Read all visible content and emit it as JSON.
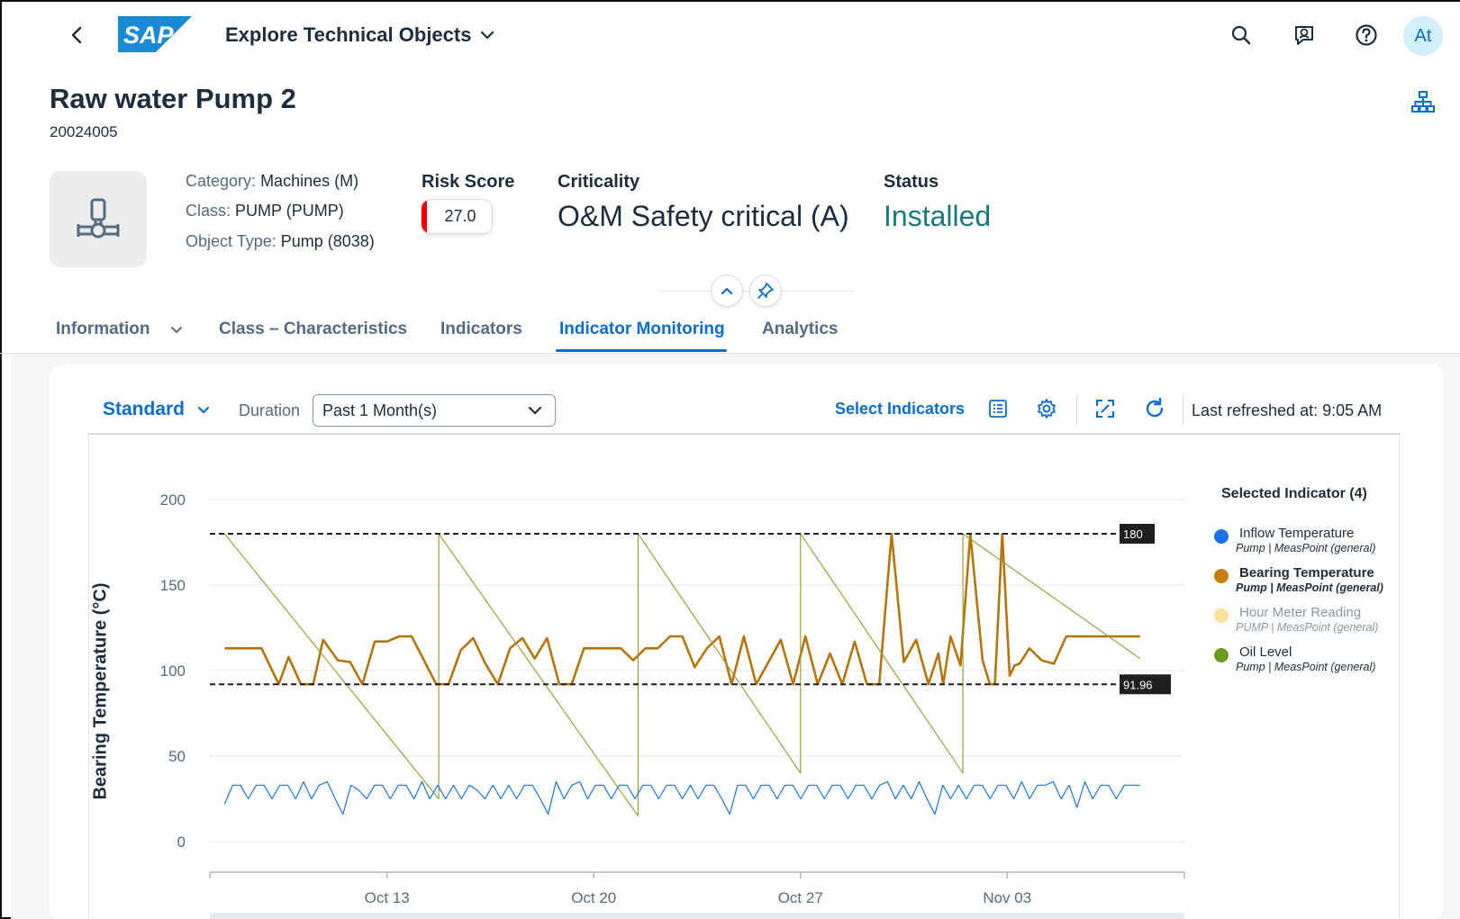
{
  "shell": {
    "logo_text": "SAP",
    "app_title": "Explore Technical Objects",
    "avatar_initials": "At",
    "icons": [
      "back-icon",
      "search-icon",
      "feedback-icon",
      "help-icon"
    ]
  },
  "object": {
    "title": "Raw water Pump 2",
    "id": "20024005",
    "attributes": [
      {
        "label": "Category:",
        "value": "Machines (M)"
      },
      {
        "label": "Class:",
        "value": "PUMP (PUMP)"
      },
      {
        "label": "Object Type:",
        "value": "Pump (8038)"
      }
    ],
    "risk_label": "Risk Score",
    "risk_value": "27.0",
    "criticality_label": "Criticality",
    "criticality_value": "O&M Safety critical (A)",
    "status_label": "Status",
    "status_value": "Installed",
    "status_color": "#1a7a7a"
  },
  "tabs": [
    {
      "label": "Information",
      "has_dropdown": true
    },
    {
      "label": "Class – Characteristics"
    },
    {
      "label": "Indicators"
    },
    {
      "label": "Indicator Monitoring",
      "active": true
    },
    {
      "label": "Analytics"
    }
  ],
  "toolbar": {
    "variant": "Standard",
    "duration_label": "Duration",
    "duration_value": "Past 1 Month(s)",
    "select_indicators": "Select Indicators",
    "last_refreshed_label": "Last refreshed at:",
    "last_refreshed_time": "9:05 AM",
    "icons": [
      "table-view-icon",
      "settings-icon",
      "fullscreen-icon",
      "refresh-icon"
    ]
  },
  "legend": {
    "title": "Selected Indicator (4)",
    "items": [
      {
        "name": "Inflow Temperature",
        "sub": "Pump | MeasPoint (general)",
        "color": "#1a73e8"
      },
      {
        "name": "Bearing Temperature",
        "sub": "Pump | MeasPoint (general)",
        "color": "#c87d0e"
      },
      {
        "name": "Hour Meter Reading",
        "sub": "PUMP | MeasPoint (general)",
        "color": "#fbe29a"
      },
      {
        "name": "Oil Level",
        "sub": "Pump | MeasPoint (general)",
        "color": "#6b9b1e"
      }
    ]
  },
  "chart_data": {
    "type": "line",
    "ylabel": "Bearing Temperature (°C)",
    "ylim": [
      0,
      200
    ],
    "yticks": [
      0,
      50,
      100,
      150,
      200
    ],
    "xlim": [
      "2024-10-07",
      "2024-11-09"
    ],
    "xticks": [
      {
        "date": "2024-10-13",
        "label": "Oct 13"
      },
      {
        "date": "2024-10-20",
        "label": "Oct 20"
      },
      {
        "date": "2024-10-27",
        "label": "Oct 27"
      },
      {
        "date": "2024-11-03",
        "label": "Nov 03"
      }
    ],
    "thresholds": [
      {
        "value": 180,
        "label": "180"
      },
      {
        "value": 91.96,
        "label": "91.96"
      }
    ],
    "grid": true,
    "legend_position": "right",
    "series": [
      {
        "name": "Bearing Temperature",
        "color": "#b5740c",
        "x": [
          "2024-10-07 12:00",
          "2024-10-08 06:00",
          "2024-10-08 18:00",
          "2024-10-09 08:00",
          "2024-10-09 16:00",
          "2024-10-10 02:00",
          "2024-10-10 12:00",
          "2024-10-10 20:00",
          "2024-10-11 08:00",
          "2024-10-11 18:00",
          "2024-10-12 04:00",
          "2024-10-12 14:00",
          "2024-10-13 00:00",
          "2024-10-13 10:00",
          "2024-10-13 20:00",
          "2024-10-14 06:00",
          "2024-10-14 16:00",
          "2024-10-15 02:00",
          "2024-10-15 12:00",
          "2024-10-15 22:00",
          "2024-10-16 08:00",
          "2024-10-16 18:00",
          "2024-10-17 04:00",
          "2024-10-17 14:00",
          "2024-10-18 00:00",
          "2024-10-18 10:00",
          "2024-10-18 20:00",
          "2024-10-19 06:00",
          "2024-10-19 16:00",
          "2024-10-20 02:00",
          "2024-10-20 12:00",
          "2024-10-20 22:00",
          "2024-10-21 08:00",
          "2024-10-21 18:00",
          "2024-10-22 04:00",
          "2024-10-22 14:00",
          "2024-10-23 00:00",
          "2024-10-23 10:00",
          "2024-10-23 20:00",
          "2024-10-24 06:00",
          "2024-10-24 16:00",
          "2024-10-25 02:00",
          "2024-10-25 12:00",
          "2024-10-25 22:00",
          "2024-10-26 08:00",
          "2024-10-26 18:00",
          "2024-10-27 04:00",
          "2024-10-27 14:00",
          "2024-10-28 00:00",
          "2024-10-28 10:00",
          "2024-10-28 20:00",
          "2024-10-29 06:00",
          "2024-10-29 16:00",
          "2024-10-30 02:00",
          "2024-10-30 12:00",
          "2024-10-30 22:00",
          "2024-10-31 08:00",
          "2024-10-31 16:00",
          "2024-10-31 20:00",
          "2024-11-01 02:00",
          "2024-11-01 10:00",
          "2024-11-01 18:00",
          "2024-11-02 04:00",
          "2024-11-02 10:00",
          "2024-11-02 14:00",
          "2024-11-02 20:00",
          "2024-11-03 02:00",
          "2024-11-03 06:00",
          "2024-11-03 10:00",
          "2024-11-03 18:00",
          "2024-11-04 04:00",
          "2024-11-04 14:00",
          "2024-11-05 00:00",
          "2024-11-05 10:00",
          "2024-11-05 20:00",
          "2024-11-06 06:00",
          "2024-11-06 16:00",
          "2024-11-07 02:00",
          "2024-11-07 12:00"
        ],
        "y": [
          113,
          113,
          113,
          92,
          108,
          92,
          92,
          118,
          106,
          105,
          92,
          117,
          117,
          120,
          120,
          106,
          92,
          92,
          112,
          119,
          104,
          92,
          113,
          119,
          107,
          119,
          92,
          92,
          113,
          113,
          113,
          113,
          106,
          113,
          113,
          120,
          120,
          102,
          113,
          120,
          92,
          120,
          92,
          105,
          118,
          92,
          120,
          92,
          110,
          92,
          117,
          92,
          92,
          180,
          105,
          118,
          92,
          110,
          92,
          120,
          103,
          180,
          106,
          92,
          92,
          180,
          97,
          103,
          104,
          113,
          106,
          104,
          120,
          120,
          120,
          120,
          120,
          120,
          120
        ]
      },
      {
        "name": "Oil Level",
        "color": "#8f9b2a",
        "x": [
          "2024-10-07 12:00",
          "2024-10-14 18:00",
          "2024-10-14 18:01",
          "2024-10-21 12:00",
          "2024-10-21 12:01",
          "2024-10-27 00:00",
          "2024-10-27 00:01",
          "2024-11-01 12:00",
          "2024-11-01 12:01",
          "2024-11-07 12:00"
        ],
        "y": [
          180,
          25,
          180,
          15,
          180,
          40,
          180,
          40,
          180,
          107
        ]
      },
      {
        "name": "Inflow Temperature",
        "color": "#1a73e8",
        "x_start": "2024-10-07 12:00",
        "x_end": "2024-11-07 12:00",
        "y": [
          22,
          33,
          33,
          25,
          33,
          33,
          25,
          33,
          33,
          25,
          35,
          25,
          33,
          35,
          25,
          16,
          33,
          30,
          25,
          33,
          33,
          25,
          33,
          33,
          25,
          35,
          25,
          33,
          25,
          33,
          25,
          33,
          30,
          25,
          33,
          25,
          33,
          25,
          33,
          33,
          25,
          16,
          35,
          25,
          33,
          35,
          25,
          33,
          33,
          25,
          33,
          33,
          25,
          33,
          33,
          25,
          33,
          33,
          25,
          33,
          25,
          33,
          33,
          25,
          16,
          33,
          33,
          25,
          33,
          33,
          25,
          33,
          33,
          25,
          33,
          33,
          25,
          33,
          33,
          25,
          33,
          33,
          25,
          33,
          35,
          25,
          33,
          25,
          35,
          25,
          16,
          33,
          25,
          33,
          25,
          33,
          33,
          25,
          33,
          33,
          25,
          35,
          25,
          33,
          33,
          35,
          25,
          33,
          20,
          35,
          25,
          33,
          33,
          25,
          33,
          33,
          33
        ]
      }
    ]
  }
}
